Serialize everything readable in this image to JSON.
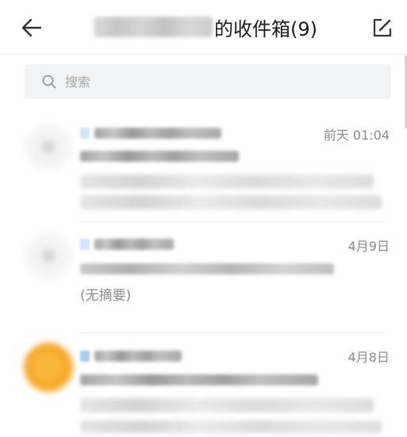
{
  "header": {
    "title_suffix": "的收件箱(9)",
    "back_icon": "arrow-left-icon",
    "compose_icon": "compose-edit-icon"
  },
  "search": {
    "placeholder": "搜索",
    "icon": "search-icon"
  },
  "mails": [
    {
      "date": "前天 01:04",
      "summary": ""
    },
    {
      "date": "4月9日",
      "summary": "(无摘要)"
    },
    {
      "date": "4月8日",
      "summary": ""
    }
  ],
  "colors": {
    "accent_avatar": "#f6a623",
    "divider": "#eeeeee",
    "search_bg": "#f2f3f5",
    "muted_text": "#8a8a8a"
  }
}
